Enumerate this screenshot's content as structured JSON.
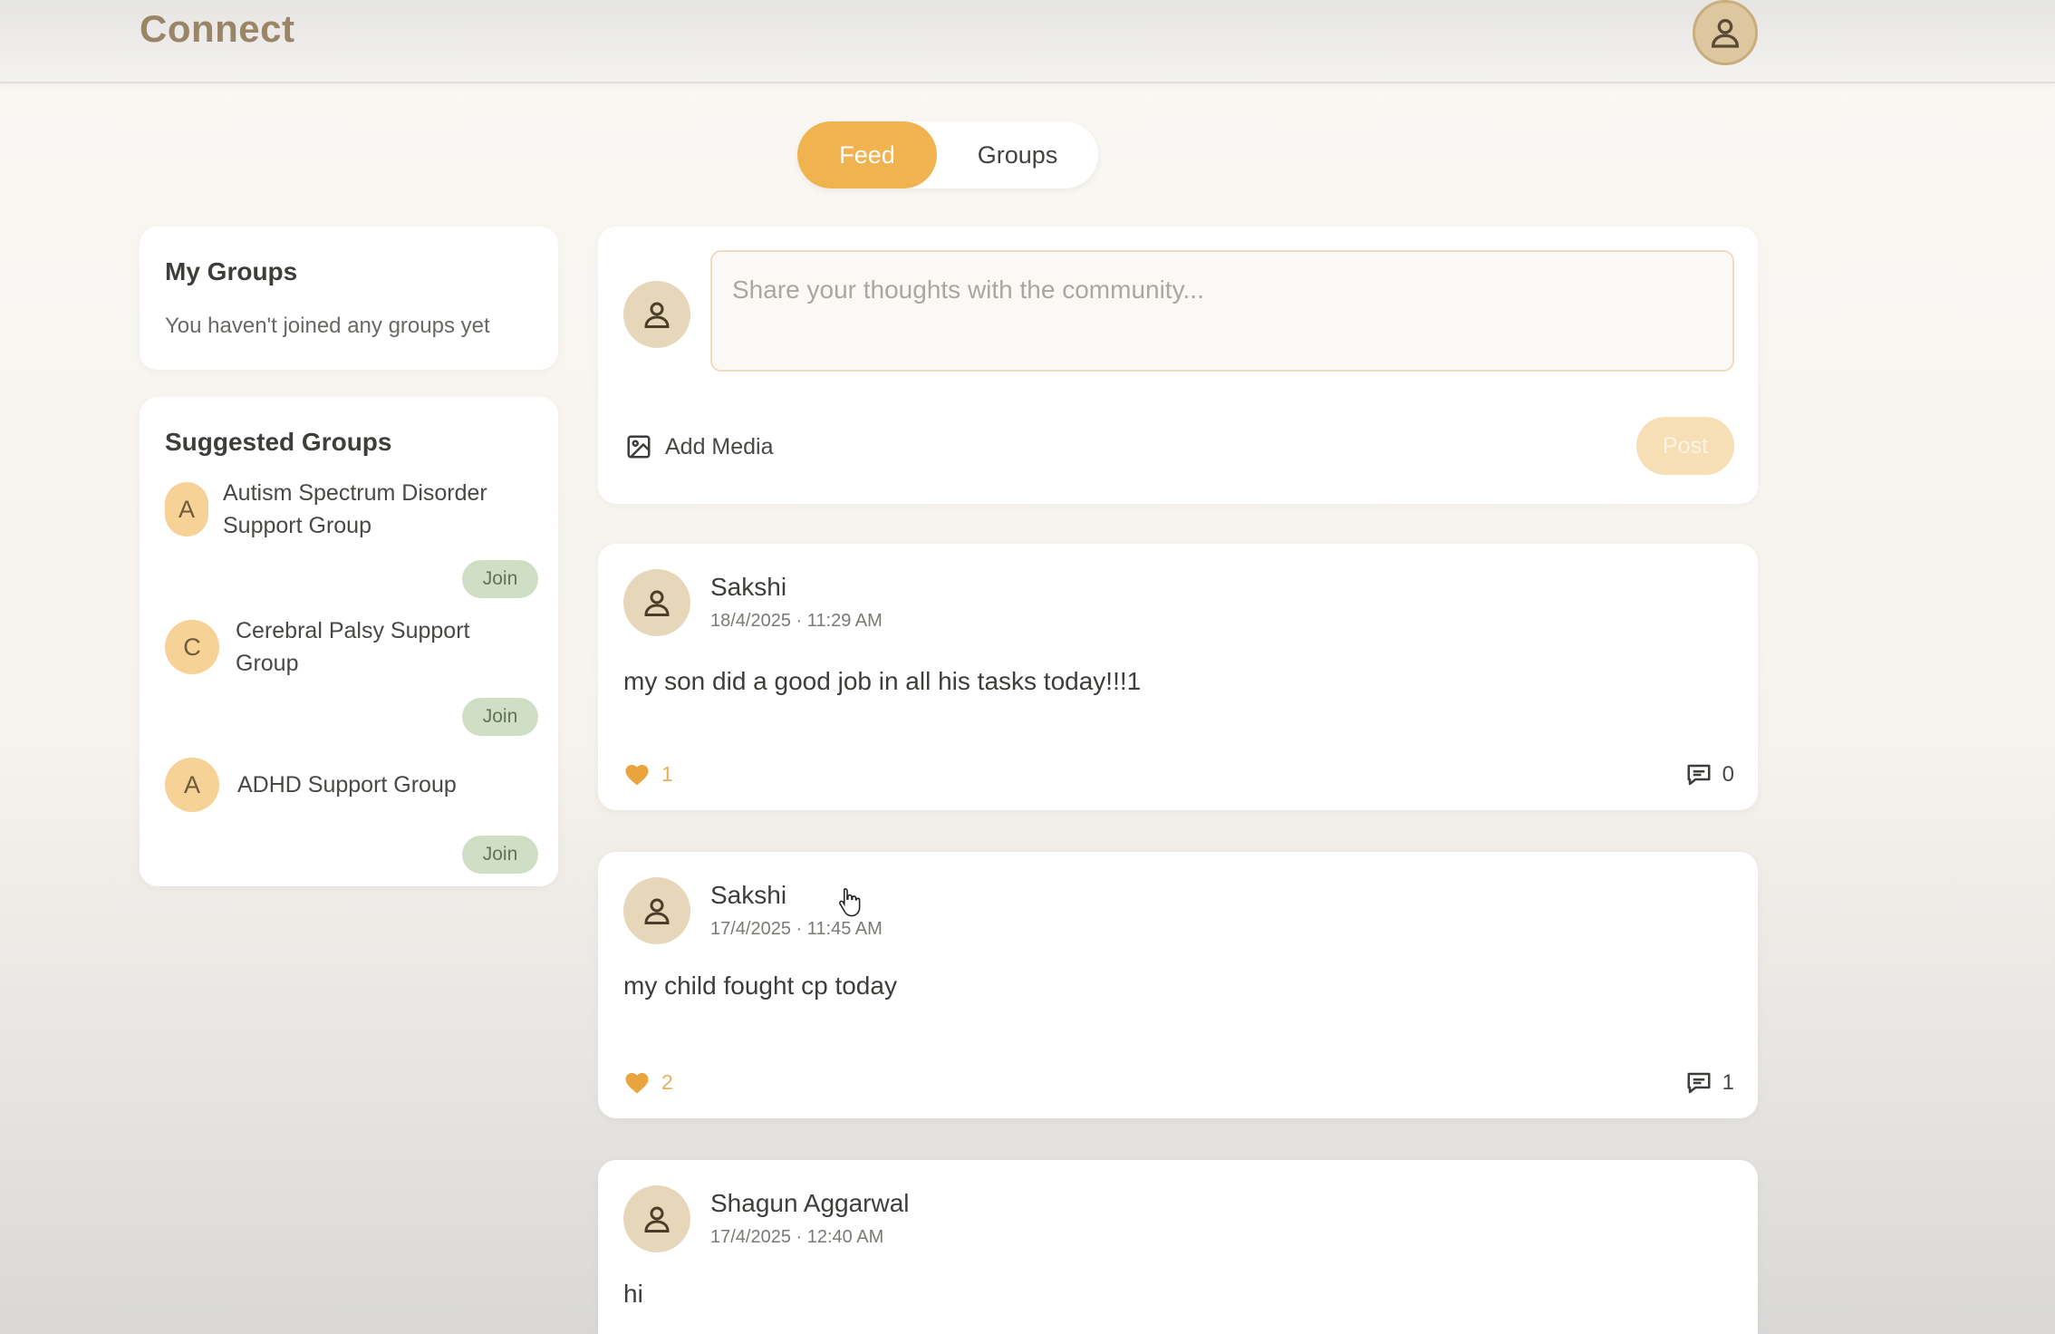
{
  "header": {
    "brand": "Connect",
    "profile_icon": "user-icon"
  },
  "tabs": [
    {
      "label": "Feed",
      "active": true
    },
    {
      "label": "Groups",
      "active": false
    }
  ],
  "my_groups": {
    "title": "My Groups",
    "empty_text": "You haven't joined any groups yet"
  },
  "suggested_groups": {
    "title": "Suggested Groups",
    "items": [
      {
        "letter": "A",
        "name_line1": "Autism Spectrum Disorder",
        "name_line2": "Support Group",
        "join_label": "Join"
      },
      {
        "letter": "C",
        "name_line1": "Cerebral Palsy Support",
        "name_line2": "Group",
        "join_label": "Join"
      },
      {
        "letter": "A",
        "name_line1": "ADHD Support Group",
        "name_line2": "",
        "join_label": "Join"
      }
    ]
  },
  "composer": {
    "placeholder": "Share your thoughts with the community...",
    "add_media_label": "Add Media",
    "post_label": "Post"
  },
  "posts": [
    {
      "author": "Sakshi",
      "timestamp": "18/4/2025 · 11:29 AM",
      "body": "my son did a good job in all his tasks today!!!1",
      "likes": "1",
      "comments": "0"
    },
    {
      "author": "Sakshi",
      "timestamp": "17/4/2025 · 11:45 AM",
      "body": "my child fought cp today",
      "likes": "2",
      "comments": "1"
    },
    {
      "author": "Shagun Aggarwal",
      "timestamp": "17/4/2025 · 12:40 AM",
      "body": "hi",
      "likes": "",
      "comments": ""
    }
  ],
  "colors": {
    "accent": "#f0b34f",
    "join": "#cfdec4",
    "avatar": "#e6d7bb",
    "brand": "#9a8566"
  }
}
